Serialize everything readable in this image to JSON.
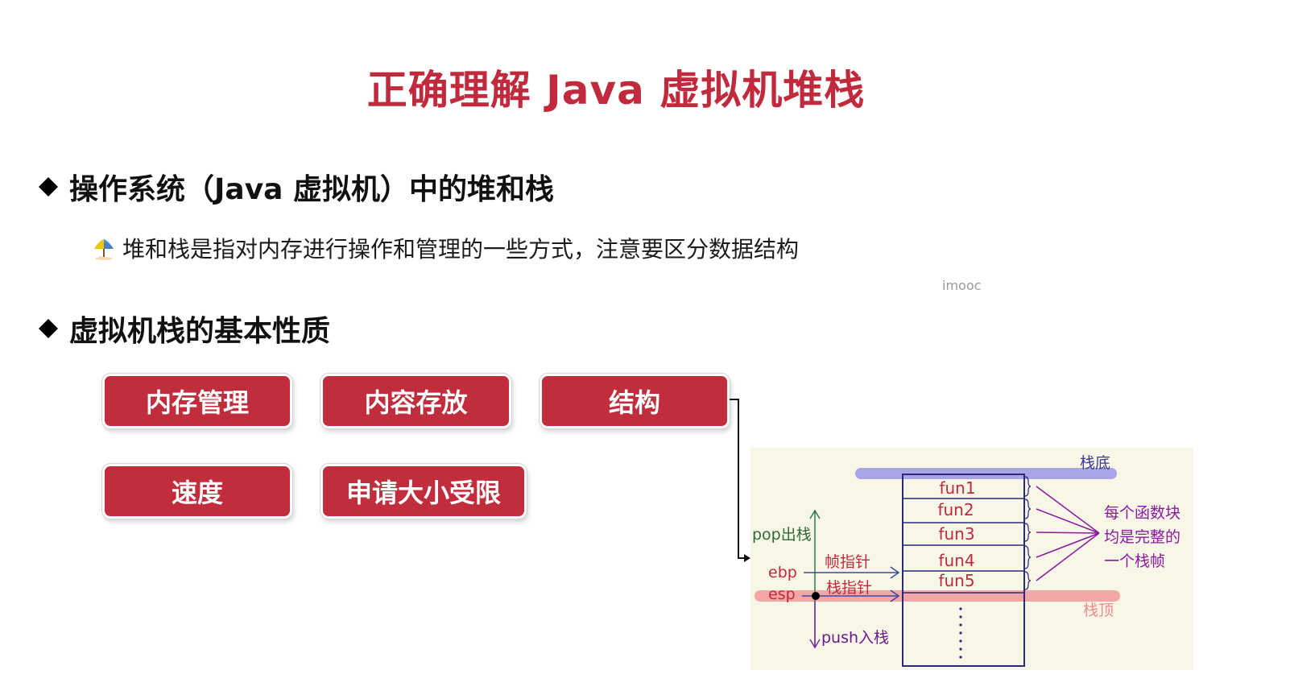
{
  "slide": {
    "title": "正确理解 Java 虚拟机堆栈",
    "watermark": "imooc"
  },
  "section1": {
    "heading": "操作系统（Java 虚拟机）中的堆和栈",
    "note": "堆和栈是指对内存进行操作和管理的一些方式，注意要区分数据结构"
  },
  "section2": {
    "heading": "虚拟机栈的基本性质",
    "tags": [
      "内存管理",
      "内容存放",
      "结构",
      "速度",
      "申请大小受限"
    ]
  },
  "diagram": {
    "stack_bottom": "栈底",
    "stack_top": "栈顶",
    "frames": [
      "fun1",
      "fun2",
      "fun3",
      "fun4",
      "fun5"
    ],
    "pop_label": "pop出栈",
    "push_label": "push入栈",
    "ebp_label": "ebp",
    "esp_label": "esp",
    "frame_pointer_label": "帧指针",
    "stack_pointer_label": "栈指针",
    "annotation_lines": [
      "每个函数块",
      "均是完整的",
      "一个栈帧"
    ]
  },
  "colors": {
    "accent": "#c12a3c",
    "tag_bg": "#c12d3d",
    "diagram_bg": "#f8f6e6",
    "bottom_bar": "#a9a6e6",
    "top_bar": "#f3a6a6",
    "annotation": "#8a1aa0"
  },
  "icons": {
    "bullet": "diamond-icon",
    "note": "umbrella-icon"
  }
}
